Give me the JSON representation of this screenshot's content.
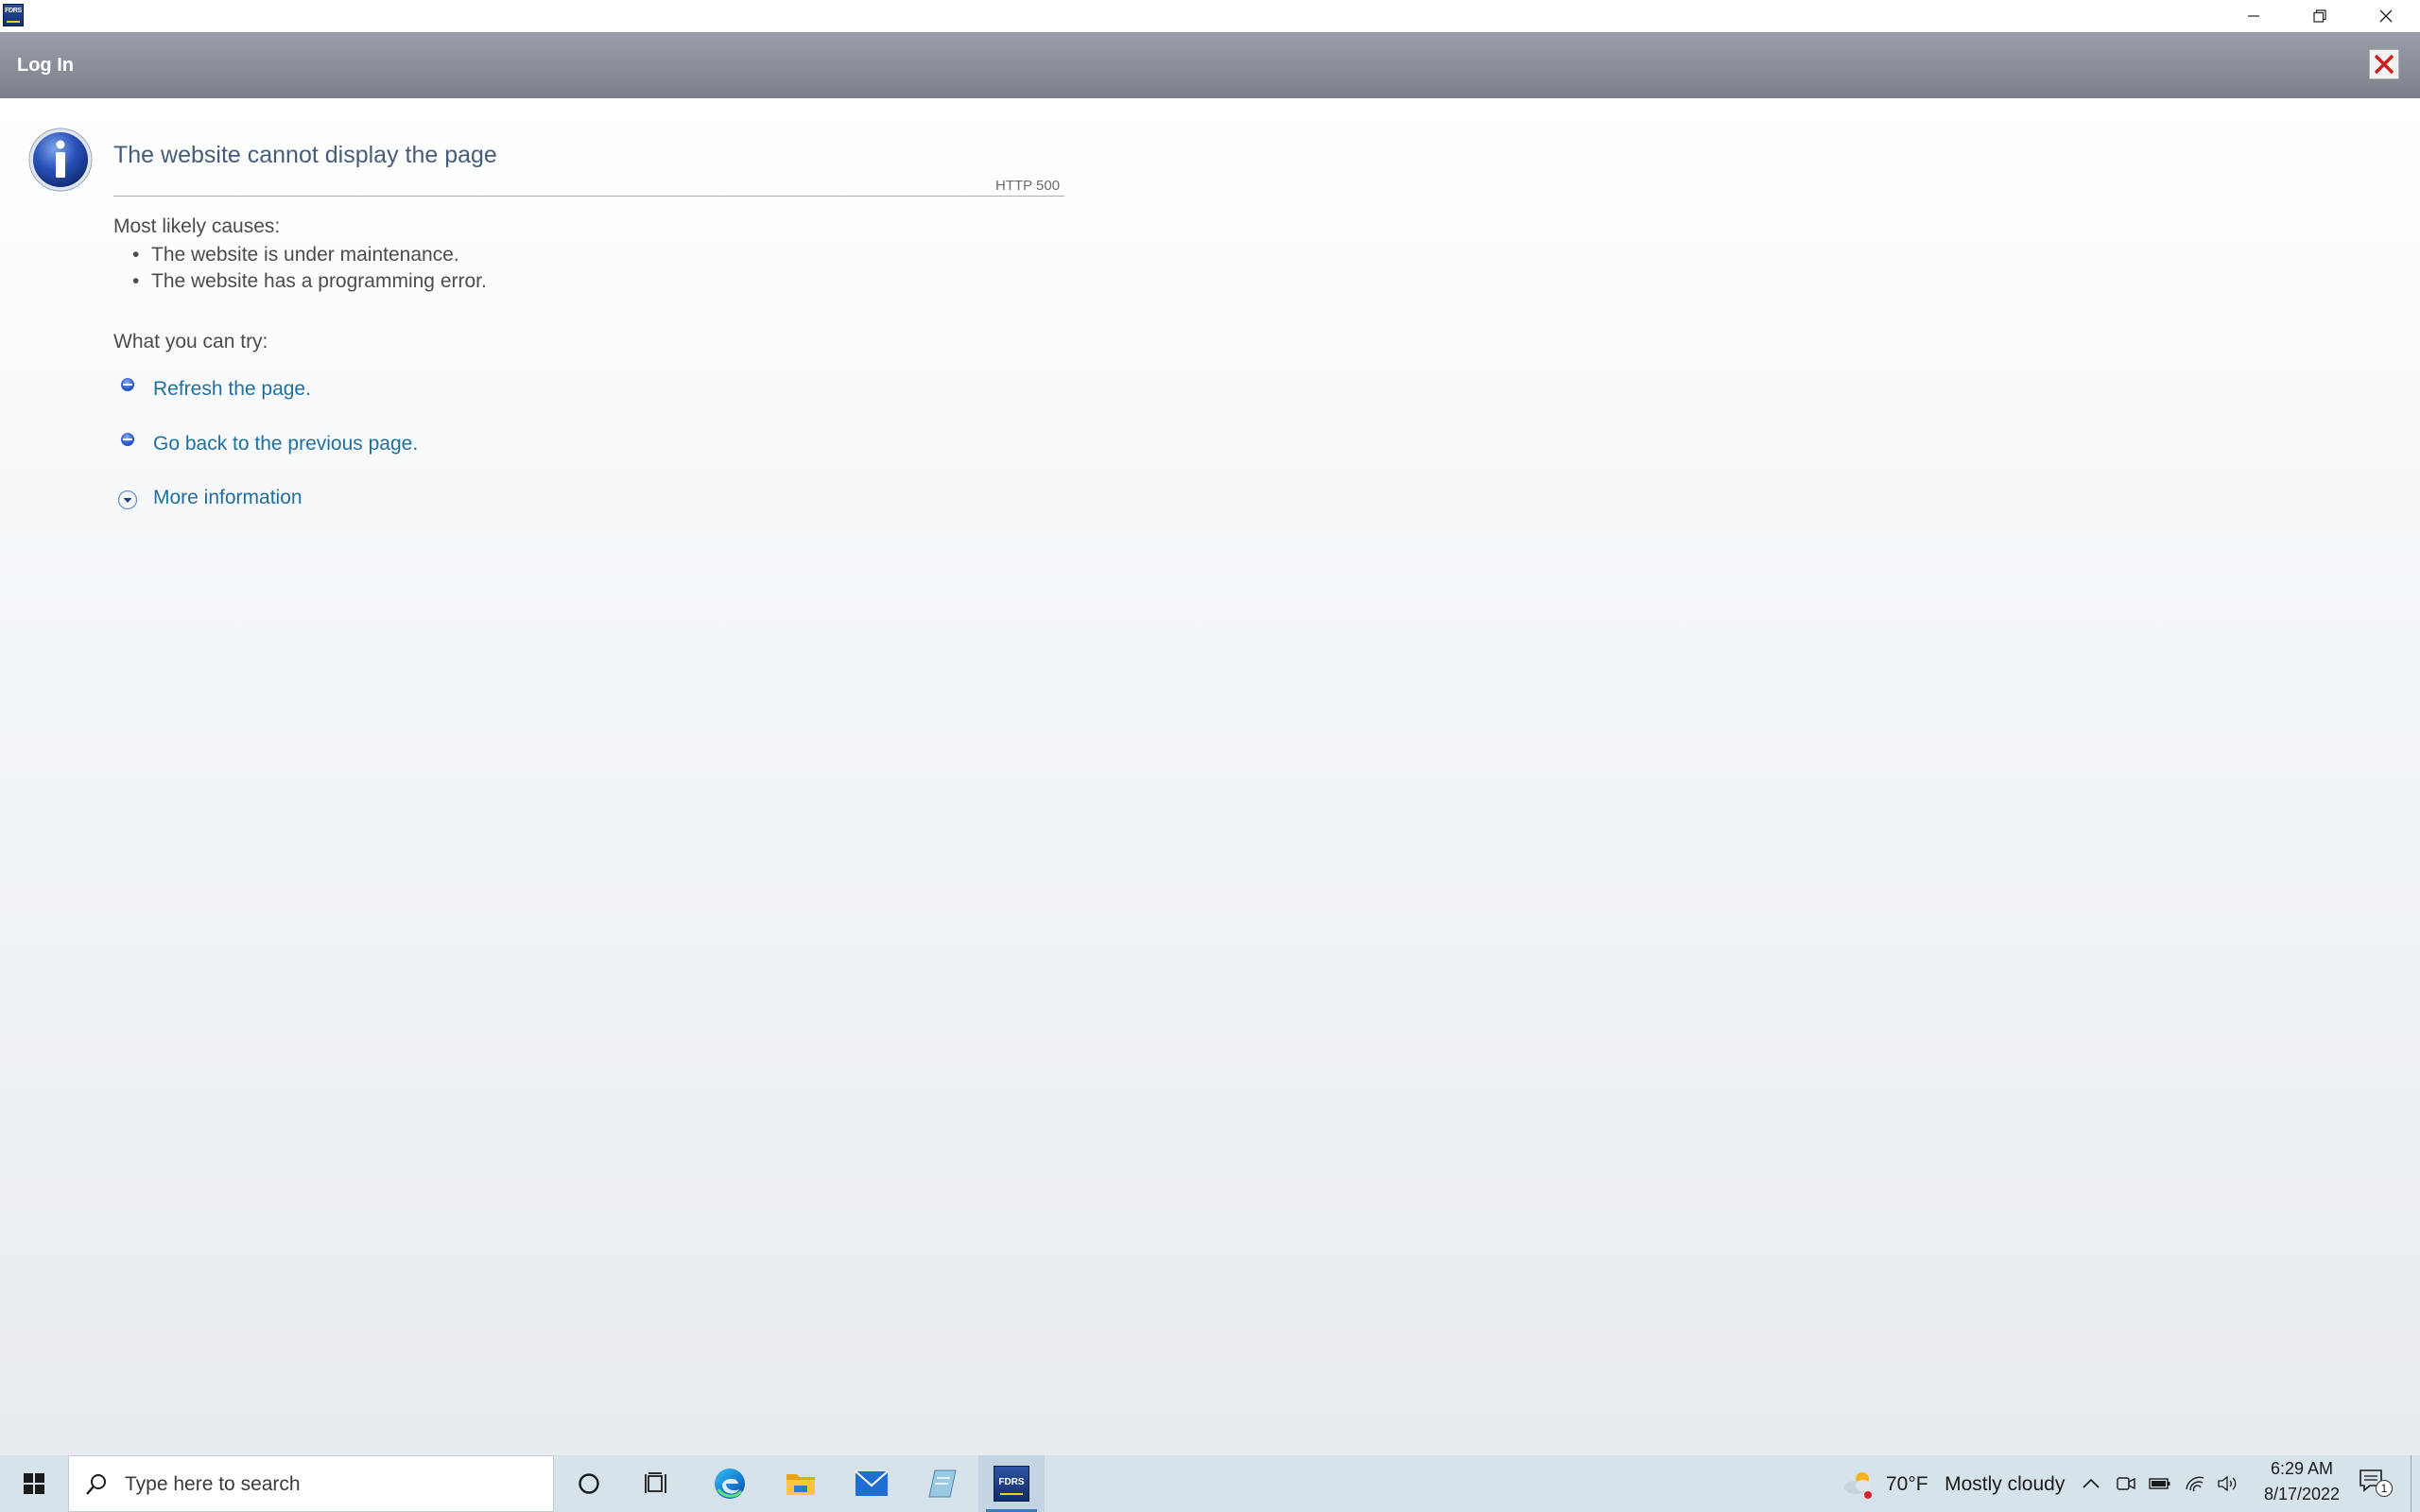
{
  "window": {
    "app_icon_text": "FDRS",
    "minimize_label": "",
    "restore_label": "",
    "close_label": ""
  },
  "header": {
    "title": "Log In"
  },
  "error": {
    "title": "The website cannot display the page",
    "code": "HTTP 500",
    "causes_label": "Most likely causes:",
    "causes": [
      "The website is under maintenance.",
      "The website has a programming error."
    ],
    "try_label": "What you can try:",
    "actions": [
      "Refresh the page.",
      "Go back to the previous page."
    ],
    "more_info": "More information"
  },
  "taskbar": {
    "search_placeholder": "Type here to search",
    "fdrs_label": "FDRS",
    "weather": {
      "temperature": "70°F",
      "condition": "Mostly cloudy"
    },
    "time": "6:29 AM",
    "date": "8/17/2022",
    "notification_count": "1"
  },
  "colors": {
    "header_bar": "#888c96",
    "link": "#1f6fa0",
    "title": "#445d7a",
    "taskbar": "#d7e3eb",
    "close_x": "#d0201e"
  },
  "icons": {
    "app": "fdrs-app-icon",
    "info": "info-icon",
    "start": "windows-logo-icon",
    "search": "search-icon",
    "cortana": "cortana-icon",
    "task_view": "task-view-icon",
    "edge": "edge-icon",
    "explorer": "file-explorer-icon",
    "mail": "mail-icon",
    "weather": "partly-cloudy-icon"
  }
}
